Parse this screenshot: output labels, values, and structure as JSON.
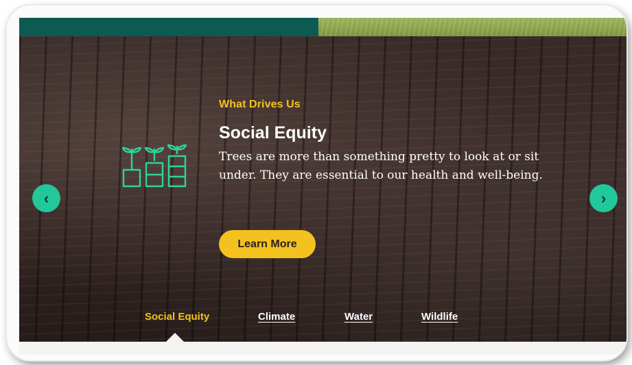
{
  "hero": {
    "eyebrow": "What Drives Us",
    "title": "Social Equity",
    "description": "Trees are more than something pretty to look at or sit under. They are essential to our health and well-being.",
    "cta_label": "Learn More"
  },
  "carousel": {
    "prev_icon": "‹",
    "next_icon": "›"
  },
  "tabs": [
    {
      "label": "Social Equity",
      "active": true
    },
    {
      "label": "Climate",
      "active": false
    },
    {
      "label": "Water",
      "active": false
    },
    {
      "label": "Wildlife",
      "active": false
    }
  ],
  "colors": {
    "accent_yellow": "#f4c21f",
    "arrow_green": "#22c79a",
    "icon_green": "#2fd39a",
    "teal_bar": "#0d5a53"
  },
  "icons": {
    "feature": "seedling-planters-icon"
  }
}
